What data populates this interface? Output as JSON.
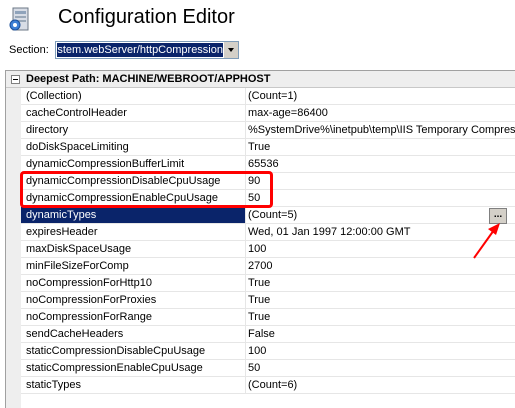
{
  "header": {
    "title": "Configuration Editor"
  },
  "section": {
    "label": "Section:",
    "value": "system.webServer/httpCompression"
  },
  "group": {
    "text": "Deepest Path: MACHINE/WEBROOT/APPHOST"
  },
  "rows": [
    {
      "name": "(Collection)",
      "value": "(Count=1)"
    },
    {
      "name": "cacheControlHeader",
      "value": "max-age=86400"
    },
    {
      "name": "directory",
      "value": "%SystemDrive%\\inetpub\\temp\\IIS Temporary Compressed Files"
    },
    {
      "name": "doDiskSpaceLimiting",
      "value": "True"
    },
    {
      "name": "dynamicCompressionBufferLimit",
      "value": "65536"
    },
    {
      "name": "dynamicCompressionDisableCpuUsage",
      "value": "90"
    },
    {
      "name": "dynamicCompressionEnableCpuUsage",
      "value": "50"
    },
    {
      "name": "dynamicTypes",
      "value": "(Count=5)"
    },
    {
      "name": "expiresHeader",
      "value": "Wed, 01 Jan 1997 12:00:00 GMT"
    },
    {
      "name": "maxDiskSpaceUsage",
      "value": "100"
    },
    {
      "name": "minFileSizeForComp",
      "value": "2700"
    },
    {
      "name": "noCompressionForHttp10",
      "value": "True"
    },
    {
      "name": "noCompressionForProxies",
      "value": "True"
    },
    {
      "name": "noCompressionForRange",
      "value": "True"
    },
    {
      "name": "sendCacheHeaders",
      "value": "False"
    },
    {
      "name": "staticCompressionDisableCpuUsage",
      "value": "100"
    },
    {
      "name": "staticCompressionEnableCpuUsage",
      "value": "50"
    },
    {
      "name": "staticTypes",
      "value": "(Count=6)"
    }
  ],
  "ellipsis_label": "...",
  "colors": {
    "selection": "#0a246a",
    "highlight": "#ff0000"
  },
  "icons": {
    "app": "config-editor-icon",
    "collapse": "collapse-minus-icon",
    "dropdown": "chevron-down-icon",
    "annotation": "red-arrow-icon"
  }
}
